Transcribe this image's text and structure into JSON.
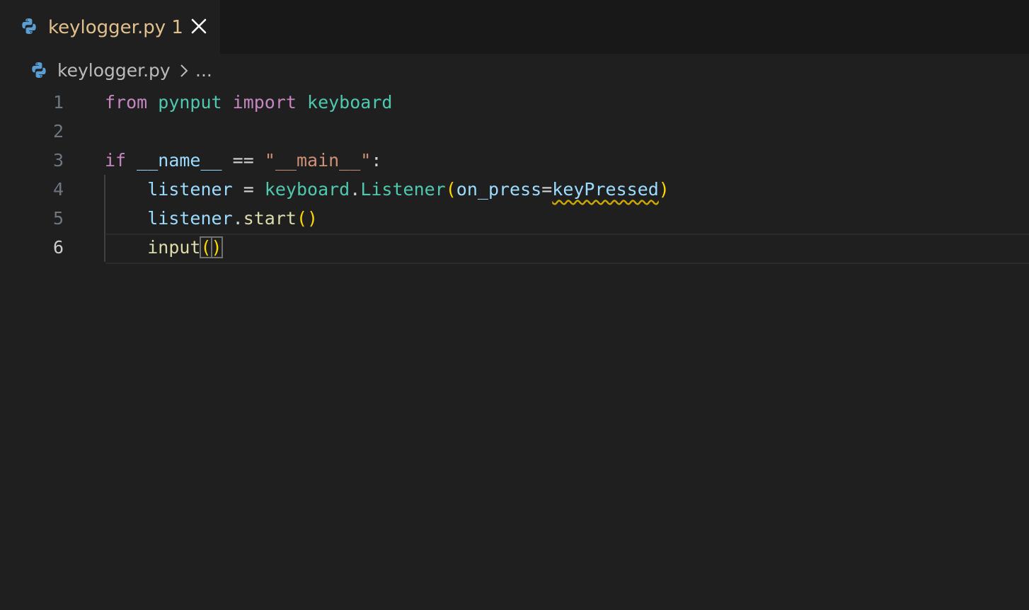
{
  "tab": {
    "filename": "keylogger.py",
    "problem_count": "1",
    "close_icon": "close-icon",
    "file_icon": "python-icon"
  },
  "breadcrumb": {
    "file": "keylogger.py",
    "separator_icon": "chevron-right-icon",
    "ellipsis": "..."
  },
  "editor": {
    "active_line": 6,
    "lines": [
      {
        "number": "1",
        "text": "from pynput import keyboard"
      },
      {
        "number": "2",
        "text": ""
      },
      {
        "number": "3",
        "text": "if __name__ == \"__main__\":"
      },
      {
        "number": "4",
        "text": "    listener = keyboard.Listener(on_press=keyPressed)"
      },
      {
        "number": "5",
        "text": "    listener.start()"
      },
      {
        "number": "6",
        "text": "    input()"
      }
    ],
    "tokens": {
      "l1": [
        "from",
        " ",
        "pynput",
        " ",
        "import",
        " ",
        "keyboard"
      ],
      "l3": [
        "if",
        " ",
        "__name__",
        " ",
        "==",
        " ",
        "\"__main__\"",
        ":"
      ],
      "l4": [
        "    ",
        "listener",
        " ",
        "=",
        " ",
        "keyboard",
        ".",
        "Listener",
        "(",
        "on_press",
        "=",
        "keyPressed",
        ")"
      ],
      "l5": [
        "    ",
        "listener",
        ".",
        "start",
        "()"
      ],
      "l6": [
        "    ",
        "input",
        "(",
        ")"
      ]
    }
  },
  "colors": {
    "background": "#1f1f1f",
    "tab_modified": "#e2c08d",
    "keyword": "#c586c0",
    "variable": "#9cdcfe",
    "string": "#ce9178",
    "class": "#4ec9b0",
    "function": "#dcdcaa",
    "bracket": "#ffd700",
    "warning_squiggle": "#cca700"
  }
}
